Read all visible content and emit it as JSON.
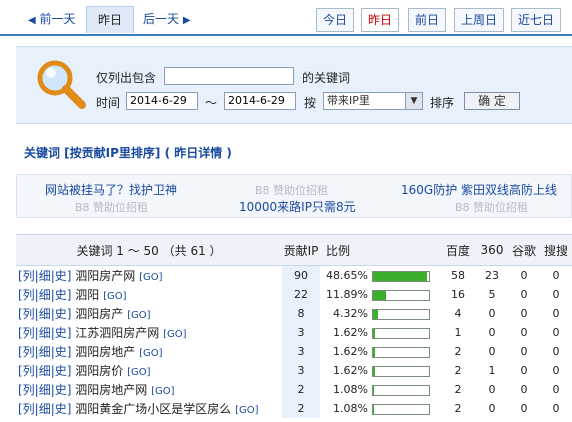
{
  "datebar": {
    "prev": "前一天",
    "current": "昨日",
    "next": "后一天",
    "quick": [
      {
        "label": "今日",
        "active": false
      },
      {
        "label": "昨日",
        "active": true
      },
      {
        "label": "前日",
        "active": false
      },
      {
        "label": "上周日",
        "active": false
      },
      {
        "label": "近七日",
        "active": false
      }
    ]
  },
  "filter": {
    "include_label": "仅列出包含",
    "include_value": "",
    "keyword_suffix": "的关键词",
    "time_label": "时间",
    "date_from": "2014-6-29",
    "range_sep": "～",
    "date_to": "2014-6-29",
    "by_label": "按",
    "sort_value": "带来IP里",
    "sort_suffix": "排序",
    "confirm": "确 定"
  },
  "section_title": "关键词 [按贡献IP里排序] ( 昨日详情 )",
  "ads": {
    "a1": "网站被挂马了？找护卫神",
    "a2": "B8 赞助位招租",
    "a3": "160G防护 紫田双线高防上线",
    "a4": "B8 赞助位招租",
    "a5": "10000来路IP只需8元",
    "a6": "B8 赞助位招租"
  },
  "table": {
    "headers": {
      "keyword": "关键词 1 ～ 50 （共 61 ）",
      "ip": "贡献IP",
      "ratio": "比例",
      "baidu": "百度",
      "s360": "360",
      "google": "谷歌",
      "sogou": "搜搜"
    },
    "row_prefix": "[列|细|史]",
    "go": "[GO]",
    "rows": [
      {
        "keyword": "泗阳房产网",
        "ip": "90",
        "ratio": "48.65%",
        "pct": 48.65,
        "baidu": "58",
        "s360": "23",
        "google": "0",
        "sogou": "0"
      },
      {
        "keyword": "泗阳",
        "ip": "22",
        "ratio": "11.89%",
        "pct": 11.89,
        "baidu": "16",
        "s360": "5",
        "google": "0",
        "sogou": "0"
      },
      {
        "keyword": "泗阳房产",
        "ip": "8",
        "ratio": "4.32%",
        "pct": 4.32,
        "baidu": "4",
        "s360": "0",
        "google": "0",
        "sogou": "0"
      },
      {
        "keyword": "江苏泗阳房产网",
        "ip": "3",
        "ratio": "1.62%",
        "pct": 1.62,
        "baidu": "1",
        "s360": "0",
        "google": "0",
        "sogou": "0"
      },
      {
        "keyword": "泗阳房地产",
        "ip": "3",
        "ratio": "1.62%",
        "pct": 1.62,
        "baidu": "2",
        "s360": "0",
        "google": "0",
        "sogou": "0"
      },
      {
        "keyword": "泗阳房价",
        "ip": "3",
        "ratio": "1.62%",
        "pct": 1.62,
        "baidu": "2",
        "s360": "1",
        "google": "0",
        "sogou": "0"
      },
      {
        "keyword": "泗阳房地产网",
        "ip": "2",
        "ratio": "1.08%",
        "pct": 1.08,
        "baidu": "2",
        "s360": "0",
        "google": "0",
        "sogou": "0"
      },
      {
        "keyword": "泗阳黄金广场小区是学区房么",
        "ip": "2",
        "ratio": "1.08%",
        "pct": 1.08,
        "baidu": "2",
        "s360": "0",
        "google": "0",
        "sogou": "0"
      }
    ]
  }
}
